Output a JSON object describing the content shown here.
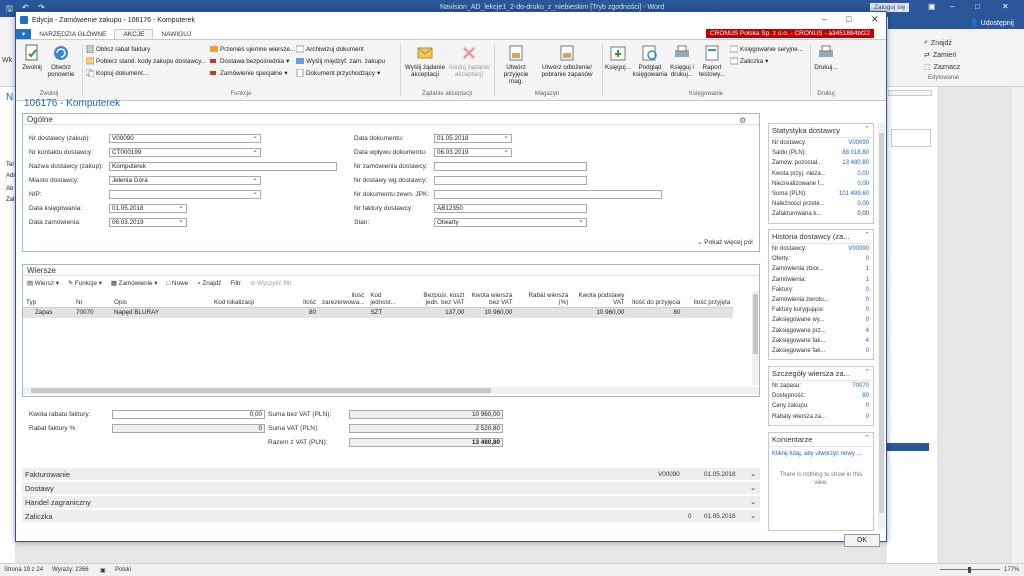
{
  "word": {
    "title": "Navision_AD_lekcje1_2-do-druku_z_niebieskim [Tryb zgodności] - Word",
    "login": "Zaloguj się",
    "share": "Udostępnij",
    "find": "Znajdź",
    "replace": "Zamień",
    "select": "Zaznacz",
    "editing_group": "Edytowanie",
    "doc_snippets": [
      "Wk",
      "N",
      "Tel",
      "Adr",
      "Ab",
      "Zał"
    ],
    "status": {
      "page": "Strona 19 z 24",
      "words": "Wyrazy: 2366",
      "lang": "Polski",
      "zoom": "177%"
    }
  },
  "nav": {
    "title": "Edycja - Zamówienie zakupu - 106176 - Komputerek",
    "company": "CRONUS Polska Sp. z o.o. - CRONUS - a3451884bf22",
    "tabs": {
      "file": "▾",
      "home": "NARZĘDZIA GŁÓWNE",
      "actions": "AKCJE",
      "navigate": "NAWIGUJ"
    },
    "ribbon": {
      "release": "Zwolnij",
      "reopen": "Otwórz ponownie",
      "release_group": "Zwolnij",
      "calc_discount": "Oblicz rabat faktury",
      "get_std_codes": "Pobierz stand. kody zakupu dostawcy...",
      "copy_doc": "Kopiuj dokument...",
      "move_neg": "Przenieś ujemne wiersze...",
      "drop_ship": "Dostawa bezpośrednia",
      "special_order": "Zamówienie specjalne",
      "archive": "Archiwizuj dokument",
      "send_ic": "Wyślij międzyf. zam. zakupu",
      "incoming_doc": "Dokument przychodzący",
      "functions_group": "Funkcje",
      "send_approval": "Wyślij żądanie akceptacji",
      "cancel_approval": "Anuluj żądanie akceptacji",
      "approval_group": "Żądanie akceptacji",
      "create_whse": "Utwórz przyjęcie mag.",
      "create_putaway": "Utwórz odłożenie/ pobranie zapasów",
      "warehouse_group": "Magazyn",
      "post": "Księguj...",
      "preview": "Podgląd księgowania",
      "post_print": "Księguj i drukuj...",
      "test_report": "Raport testowy...",
      "post_batch": "Księgowanie seryjne...",
      "prepayment": "Zaliczka",
      "posting_group": "Księgowanie",
      "print": "Drukuj...",
      "print_group": "Drukuj"
    },
    "page_title": "106176 - Komputerek"
  },
  "general": {
    "header": "Ogólne",
    "vendor_no_label": "Nr dostawcy (zakup):",
    "vendor_no": "V00090",
    "contact_label": "Nr kontaktu dostawcy:",
    "contact": "CT000199",
    "name_label": "Nazwa dostawcy (zakup):",
    "name": "Komputerek",
    "city_label": "Miasto dostawcy:",
    "city": "Jelenia Góra",
    "nip_label": "NIP:",
    "nip": "",
    "posting_date_label": "Data księgowania:",
    "posting_date": "01.05.2018",
    "order_date_label": "Data zamówienia:",
    "order_date": "06.03.2019",
    "doc_date_label": "Data dokumentu:",
    "doc_date": "01.05.2018",
    "receipt_date_label": "Data wpływu dokumentu:",
    "receipt_date": "06.03.2019",
    "vendor_order_label": "Nr zamówienia dostawcy:",
    "vendor_order": "",
    "vendor_ship_label": "Nr dostawy wg dostawcy:",
    "vendor_ship": "",
    "ext_doc_label": "Nr dokumentu zewn. JPK:",
    "ext_doc": "",
    "vendor_inv_label": "Nr faktury dostawcy:",
    "vendor_inv": "AB12350",
    "status_label": "Stan:",
    "status": "Otwarty",
    "show_more": "Pokaż więcej pól"
  },
  "lines": {
    "header": "Wiersze",
    "toolbar": {
      "line": "Wiersz",
      "functions": "Funkcje",
      "order": "Zamówienie",
      "new": "Nowe",
      "find": "Znajdź",
      "filter": "Filtr",
      "clear_filter": "Wyczyść filtr"
    },
    "columns": [
      "Typ",
      "Nr",
      "Opis",
      "Kod lokalizacji",
      "Ilość",
      "Ilość zarezerwowa...",
      "Kod jednost...",
      "Bezpośr. koszt jedn. bez VAT",
      "Kwota wiersza bez VAT",
      "Rabat wiersza (%)",
      "Kwota podstawy VAT",
      "Ilość do przyjęcia",
      "Ilość przyjęta"
    ],
    "rows": [
      [
        "Zapas",
        "70070",
        "Napęd BLURAY",
        "",
        "80",
        "",
        "SZT",
        "137,00",
        "10 960,00",
        "",
        "10 960,00",
        "80",
        ""
      ]
    ]
  },
  "totals": {
    "inv_disc_label": "Kwota rabatu faktury:",
    "inv_disc": "0,00",
    "inv_disc_pct_label": "Rabat faktury %:",
    "inv_disc_pct": "0",
    "total_excl_label": "Suma bez VAT (PLN):",
    "total_excl": "10 960,00",
    "vat_label": "Suma VAT (PLN):",
    "vat": "2 520,80",
    "total_incl_label": "Razem z VAT (PLN):",
    "total_incl": "13 480,80"
  },
  "collapsed": [
    {
      "label": "Fakturowanie",
      "v1": "V00090",
      "v2": "01.05.2018"
    },
    {
      "label": "Dostawy",
      "v1": "",
      "v2": ""
    },
    {
      "label": "Handel zagraniczny",
      "v1": "",
      "v2": ""
    },
    {
      "label": "Zaliczka",
      "v1": "0",
      "v2": "01.05.2018"
    }
  ],
  "factbox": {
    "stats": {
      "title": "Statystyka dostawcy",
      "rows": [
        {
          "l": "Nr dostawcy:",
          "v": "V00090"
        },
        {
          "l": "Saldo (PLN):",
          "v": "88 018,80"
        },
        {
          "l": "Zamów. pozostał...",
          "v": "13 480,80"
        },
        {
          "l": "Kwota przyj. nieza...",
          "v": "0,00"
        },
        {
          "l": "Niezrealizowane f...",
          "v": "0,00"
        },
        {
          "l": "Suma (PLN):",
          "v": "101 499,60"
        },
        {
          "l": "Należności przete...",
          "v": "0,00"
        },
        {
          "l": "Zafakturowana k...",
          "v": "0,00"
        }
      ]
    },
    "history": {
      "title": "Historia dostawcy (za...",
      "rows": [
        {
          "l": "Nr dostawcy:",
          "v": "V00090"
        },
        {
          "l": "Oferty:",
          "v": "0"
        },
        {
          "l": "Zamówienia zbior...",
          "v": "1"
        },
        {
          "l": "Zamówienia:",
          "v": "1"
        },
        {
          "l": "Faktury:",
          "v": "0"
        },
        {
          "l": "Zamówienia zwrotu...",
          "v": "0"
        },
        {
          "l": "Faktury korygujące:",
          "v": "0"
        },
        {
          "l": "Zaksięgowane wy...",
          "v": "0"
        },
        {
          "l": "Zaksięgowane prz...",
          "v": "4"
        },
        {
          "l": "Zaksięgowane fak...",
          "v": "4"
        },
        {
          "l": "Zaksięgowane fak...",
          "v": "0"
        }
      ]
    },
    "line_details": {
      "title": "Szczegóły wiersza za...",
      "rows": [
        {
          "l": "Nr zapasu:",
          "v": "70070"
        },
        {
          "l": "Dostępność:",
          "v": "80"
        },
        {
          "l": "Ceny zakupu:",
          "v": "0"
        },
        {
          "l": "Rabaty wiersza za...",
          "v": "0"
        }
      ]
    },
    "notes": {
      "title": "Komentarze",
      "link": "Kliknij tutaj, aby utworzyć nowy ...",
      "empty": "There is nothing to show in this view."
    }
  },
  "ok": "OK"
}
